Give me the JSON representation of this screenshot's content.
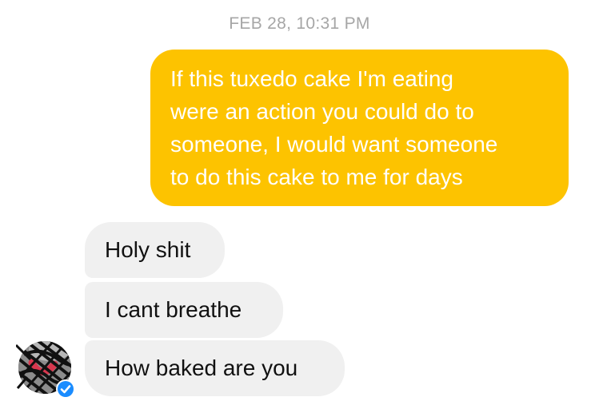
{
  "conversation": {
    "timestamp": "FEB 28, 10:31 PM",
    "outgoing": {
      "lines": [
        "If this tuxedo cake I'm eating",
        "were an action you could do to",
        "someone, I would want someone",
        "to do this cake to me for days"
      ]
    },
    "incoming": [
      {
        "text": "Holy shit"
      },
      {
        "text": "I cant breathe"
      },
      {
        "text": "How baked are you"
      }
    ]
  },
  "colors": {
    "outgoing_bubble": "#fdc300",
    "incoming_bubble": "#f0f0f0",
    "timestamp_text": "#a6a6a6",
    "verified_badge": "#1a8cff"
  },
  "icons": {
    "avatar": "scribbled-profile-photo",
    "badge": "verified-check-icon"
  }
}
